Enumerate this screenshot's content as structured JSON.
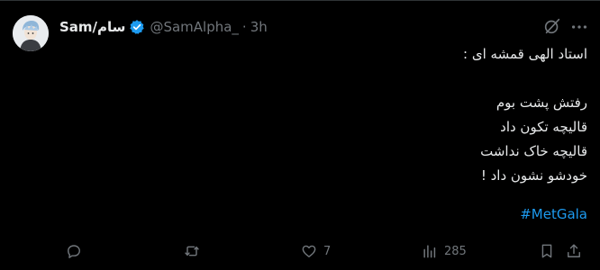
{
  "tweet": {
    "display_name": "Sam/سام",
    "handle": "@SamAlpha_",
    "separator": "·",
    "time": "3h",
    "lines": [
      "استاد الهی قمشه ای :",
      "",
      "رفتش پشت بوم",
      "قالیچه تکون داد",
      "قالیچه خاک نداشت",
      "خودشو نشون داد !"
    ],
    "hashtag": "#MetGala"
  },
  "actions": {
    "reply": {
      "icon": "reply-icon",
      "count": ""
    },
    "retweet": {
      "icon": "retweet-icon",
      "count": ""
    },
    "like": {
      "icon": "heart-icon",
      "count": "7"
    },
    "views": {
      "icon": "views-icon",
      "count": "285"
    },
    "bookmark": {
      "icon": "bookmark-icon"
    },
    "share": {
      "icon": "share-icon"
    }
  },
  "colors": {
    "background": "#000000",
    "text": "#e7e9ea",
    "muted": "#71767b",
    "accent": "#1d9bf0"
  }
}
